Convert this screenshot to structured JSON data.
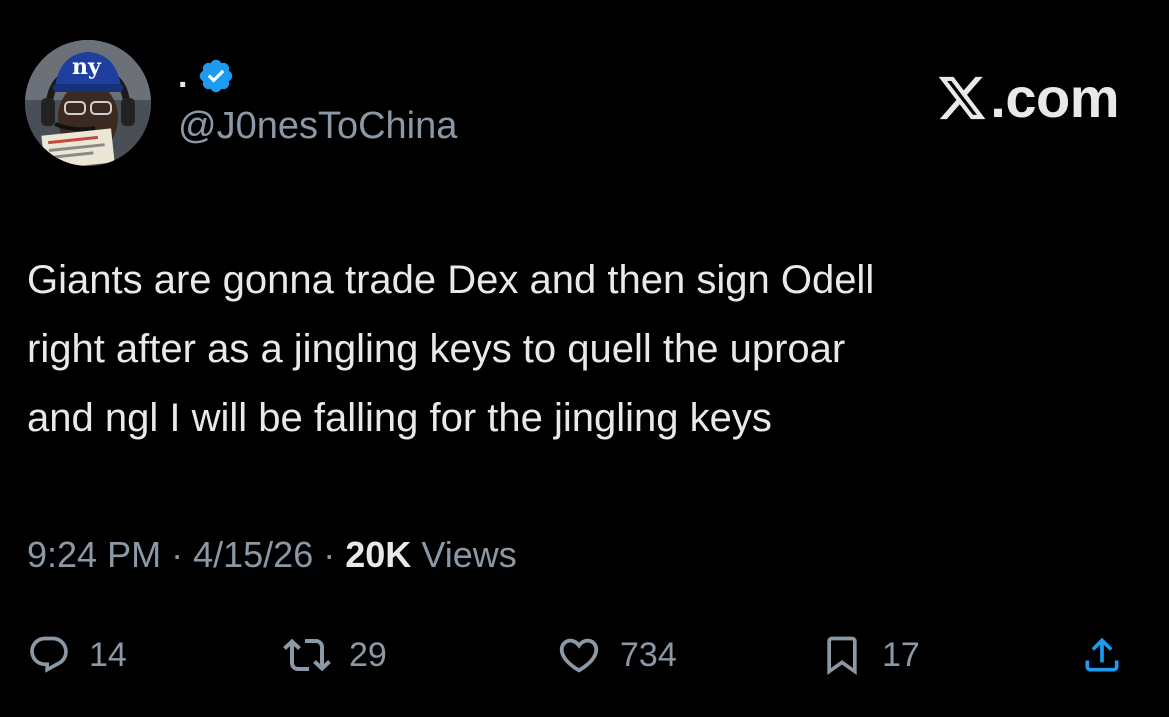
{
  "author": {
    "display_name": ".",
    "handle": "@J0nesToChina",
    "verified": true,
    "avatar_cap_text": "ny"
  },
  "brand": {
    "label": ".com"
  },
  "tweet": {
    "text": "Giants are gonna trade Dex and then sign Odell\nright after as a jingling keys to quell the uproar\nand ngl I will be falling for the jingling keys",
    "time": "9:24 PM",
    "date": "4/15/26",
    "separator": "·",
    "views_count": "20K",
    "views_label": "Views"
  },
  "actions": {
    "replies": "14",
    "reposts": "29",
    "likes": "734",
    "bookmarks": "17"
  },
  "colors": {
    "background": "#000000",
    "text_primary": "#e7e9ea",
    "text_secondary": "#8b98a5",
    "verified_badge": "#1d9bf0"
  },
  "icons": {
    "reply": "reply-icon",
    "repost": "repost-icon",
    "like": "heart-icon",
    "bookmark": "bookmark-icon",
    "share": "share-icon",
    "verified": "verified-badge-icon",
    "brand": "x-logo-icon"
  }
}
